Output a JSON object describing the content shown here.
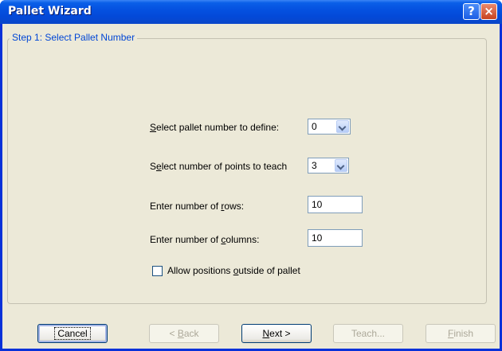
{
  "window": {
    "title": "Pallet Wizard",
    "help_glyph": "?",
    "close_glyph": "×"
  },
  "group": {
    "legend": "Step 1: Select Pallet Number"
  },
  "fields": {
    "pallet_number": {
      "label_pre": "",
      "label_u": "S",
      "label_post": "elect pallet number to define:",
      "value": "0"
    },
    "points_to_teach": {
      "label_pre": "S",
      "label_u": "e",
      "label_post": "lect number of points to teach",
      "value": "3"
    },
    "rows": {
      "label_pre": "Enter number of ",
      "label_u": "r",
      "label_post": "ows:",
      "value": "10"
    },
    "columns": {
      "label_pre": "Enter number of ",
      "label_u": "c",
      "label_post": "olumns:",
      "value": "10"
    },
    "allow_outside": {
      "label_pre": "Allow positions ",
      "label_u": "o",
      "label_post": "utside of pallet",
      "checked": false
    }
  },
  "buttons": {
    "cancel": "Cancel",
    "back": {
      "pre": "< ",
      "u": "B",
      "post": "ack"
    },
    "next": {
      "pre": "",
      "u": "N",
      "post": "ext >"
    },
    "teach": "Teach...",
    "finish": {
      "pre": "",
      "u": "F",
      "post": "inish"
    }
  }
}
